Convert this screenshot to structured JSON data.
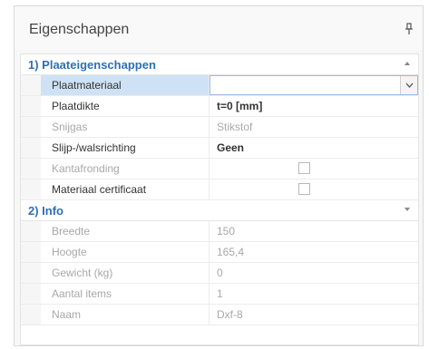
{
  "panel": {
    "title": "Eigenschappen",
    "pin_icon": "pin-icon"
  },
  "sections": [
    {
      "label": "1) Plaateigenschappen",
      "collapse_icon": "chevron-up-icon",
      "rows": [
        {
          "name": "Plaatmateriaal",
          "value": "",
          "type": "dropdown",
          "selected": true,
          "disabled": false
        },
        {
          "name": "Plaatdikte",
          "value": "t=0 [mm]",
          "type": "text",
          "bold": true,
          "disabled": false
        },
        {
          "name": "Snijgas",
          "value": "Stikstof",
          "type": "text",
          "disabled": true
        },
        {
          "name": "Slijp-/walsrichting",
          "value": "Geen",
          "type": "text",
          "bold": true,
          "disabled": false
        },
        {
          "name": "Kantafronding",
          "type": "checkbox",
          "checked": false,
          "disabled": true
        },
        {
          "name": "Materiaal certificaat",
          "type": "checkbox",
          "checked": false,
          "disabled": false
        }
      ]
    },
    {
      "label": "2) Info",
      "collapse_icon": "chevron-down-icon",
      "rows": [
        {
          "name": "Breedte",
          "value": "150",
          "type": "text",
          "disabled": true
        },
        {
          "name": "Hoogte",
          "value": "165,4",
          "type": "text",
          "disabled": true
        },
        {
          "name": "Gewicht (kg)",
          "value": "0",
          "type": "text",
          "disabled": true
        },
        {
          "name": "Aantal items",
          "value": "1",
          "type": "text",
          "disabled": true
        },
        {
          "name": "Naam",
          "value": "Dxf-8",
          "type": "text",
          "disabled": true
        }
      ]
    }
  ],
  "colors": {
    "section_label": "#2e6fb7",
    "selected_row": "#cfe2f5",
    "disabled_text": "#a8a8a8"
  }
}
